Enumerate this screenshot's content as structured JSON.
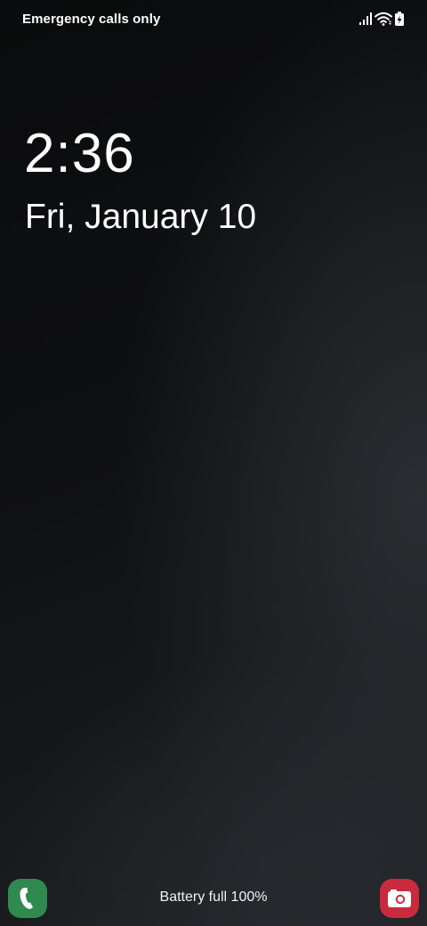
{
  "status_bar": {
    "carrier": "Emergency calls only",
    "icons": [
      "signal-icon",
      "wifi-icon",
      "battery-charging-icon"
    ]
  },
  "lock_screen": {
    "time": "2:36",
    "date": "Fri, January 10",
    "charging_status": "Battery full 100%"
  },
  "shortcuts": {
    "left": {
      "icon": "phone-icon",
      "color": "#2f8a4f"
    },
    "right": {
      "icon": "camera-icon",
      "color": "#c92a3e"
    }
  }
}
